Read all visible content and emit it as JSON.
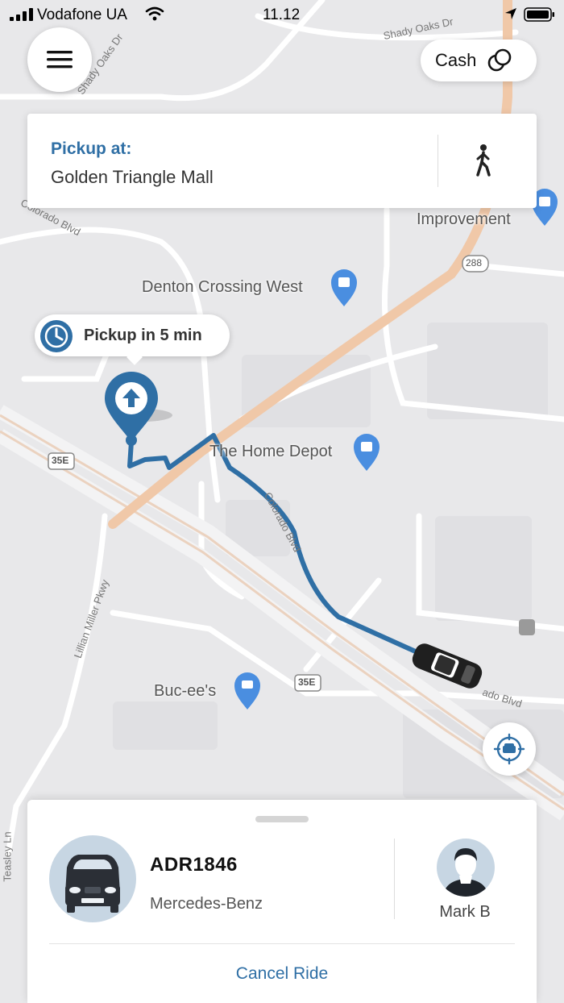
{
  "status_bar": {
    "carrier": "Vodafone UA",
    "time": "11.12"
  },
  "payment": {
    "label": "Cash",
    "icon": "coins-icon"
  },
  "pickup": {
    "label": "Pickup at:",
    "place": "Golden Triangle Mall",
    "walk_icon": "walking-person-icon"
  },
  "eta": {
    "text": "Pickup in 5 min"
  },
  "map": {
    "places": {
      "improvement": "Improvement",
      "denton_crossing": "Denton Crossing West",
      "home_depot": "The Home Depot",
      "bucees": "Buc-ee's"
    },
    "roads": {
      "shady_oaks_1": "Shady Oaks Dr",
      "shady_oaks_2": "Shady Oaks Dr",
      "colorado_1": "Colorado Blvd",
      "colorado_2": "Colorado Blvd",
      "colorado_3": "ado Blvd",
      "lillian": "Lillian Miller Pkwy",
      "teasley": "Teasley Ln",
      "hwy_288": "288",
      "i35e_1": "35E",
      "i35e_2": "35E"
    },
    "route_color": "#2f6fa5",
    "highway_color": "#f0c8a8"
  },
  "ride": {
    "plate": "ADR1846",
    "model": "Mercedes-Benz",
    "driver": "Mark B",
    "cancel_label": "Cancel Ride"
  }
}
